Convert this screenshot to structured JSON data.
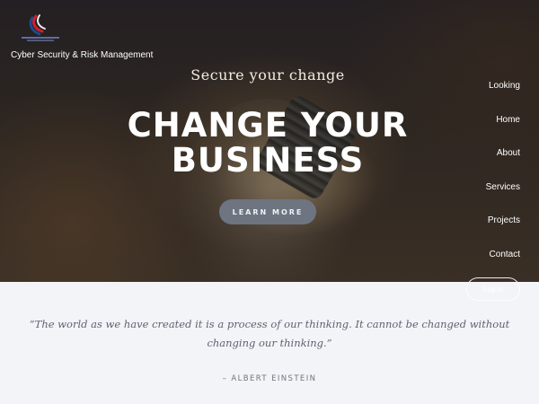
{
  "brand": {
    "tagline": "Cyber Security & Risk Management",
    "logo_icon": "shield-swoosh-icon"
  },
  "hero": {
    "subtitle": "Secure your change",
    "headline_line1": "CHANGE YOUR",
    "headline_line2": "BUSINESS",
    "cta_label": "LEARN MORE"
  },
  "nav": {
    "items": [
      {
        "label": "Looking"
      },
      {
        "label": "Home"
      },
      {
        "label": "About"
      },
      {
        "label": "Services"
      },
      {
        "label": "Projects"
      },
      {
        "label": "Contact"
      }
    ],
    "pill_label": "Log in"
  },
  "quote": {
    "text": "“The world as we have created it is a process of our thinking. It cannot be changed without changing our thinking.”",
    "author": "– ALBERT EINSTEIN"
  },
  "colors": {
    "hero_dark": "#2a2420",
    "cta_bg": "#6e7480",
    "quote_bg": "#f3f4f8",
    "quote_text": "#5e6270",
    "logo_red": "#d0202c",
    "logo_blue": "#1f4a8c"
  }
}
